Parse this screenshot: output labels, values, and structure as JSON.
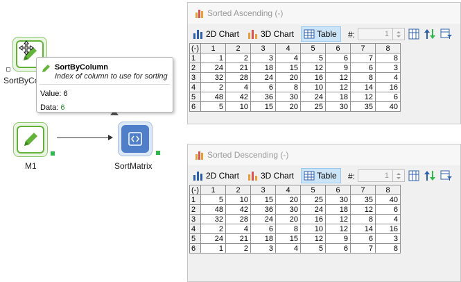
{
  "canvas": {
    "nodes": [
      {
        "label": "SortByCo"
      },
      {
        "label": "M1"
      },
      {
        "label": "SortMatrix"
      }
    ]
  },
  "tooltip": {
    "title": "SortByColumn",
    "description": "Index of column to use for sorting",
    "value_label": "Value:",
    "value": "6",
    "data_label": "Data:",
    "data": "6"
  },
  "windows": [
    {
      "title": "Sorted Ascending (-)",
      "toolbar": {
        "chart2d": "2D Chart",
        "chart3d": "3D Chart",
        "table": "Table",
        "hash": "#:",
        "spin_value": "1"
      },
      "columns": [
        "(-)",
        "1",
        "2",
        "3",
        "4",
        "5",
        "6",
        "7",
        "8"
      ],
      "rows": [
        [
          "1",
          "1",
          "2",
          "3",
          "4",
          "5",
          "6",
          "7",
          "8"
        ],
        [
          "2",
          "24",
          "21",
          "18",
          "15",
          "12",
          "9",
          "6",
          "3"
        ],
        [
          "3",
          "32",
          "28",
          "24",
          "20",
          "16",
          "12",
          "8",
          "4"
        ],
        [
          "4",
          "2",
          "4",
          "6",
          "8",
          "10",
          "12",
          "14",
          "16"
        ],
        [
          "5",
          "48",
          "42",
          "36",
          "30",
          "24",
          "18",
          "12",
          "6"
        ],
        [
          "6",
          "5",
          "10",
          "15",
          "20",
          "25",
          "30",
          "35",
          "40"
        ]
      ]
    },
    {
      "title": "Sorted Descending (-)",
      "toolbar": {
        "chart2d": "2D Chart",
        "chart3d": "3D Chart",
        "table": "Table",
        "hash": "#:",
        "spin_value": "1"
      },
      "columns": [
        "(-)",
        "1",
        "2",
        "3",
        "4",
        "5",
        "6",
        "7",
        "8"
      ],
      "rows": [
        [
          "1",
          "5",
          "10",
          "15",
          "20",
          "25",
          "30",
          "35",
          "40"
        ],
        [
          "2",
          "48",
          "42",
          "36",
          "30",
          "24",
          "18",
          "12",
          "6"
        ],
        [
          "3",
          "32",
          "28",
          "24",
          "20",
          "16",
          "12",
          "8",
          "4"
        ],
        [
          "4",
          "2",
          "4",
          "6",
          "8",
          "10",
          "12",
          "14",
          "16"
        ],
        [
          "5",
          "24",
          "21",
          "18",
          "15",
          "12",
          "9",
          "6",
          "3"
        ],
        [
          "6",
          "1",
          "2",
          "3",
          "4",
          "5",
          "6",
          "7",
          "8"
        ]
      ]
    }
  ],
  "colors": {
    "node_green": "#63b33b",
    "node_blue": "#4f7fc9",
    "port_green": "#2db84a",
    "active_tab": "#cce4f7"
  }
}
